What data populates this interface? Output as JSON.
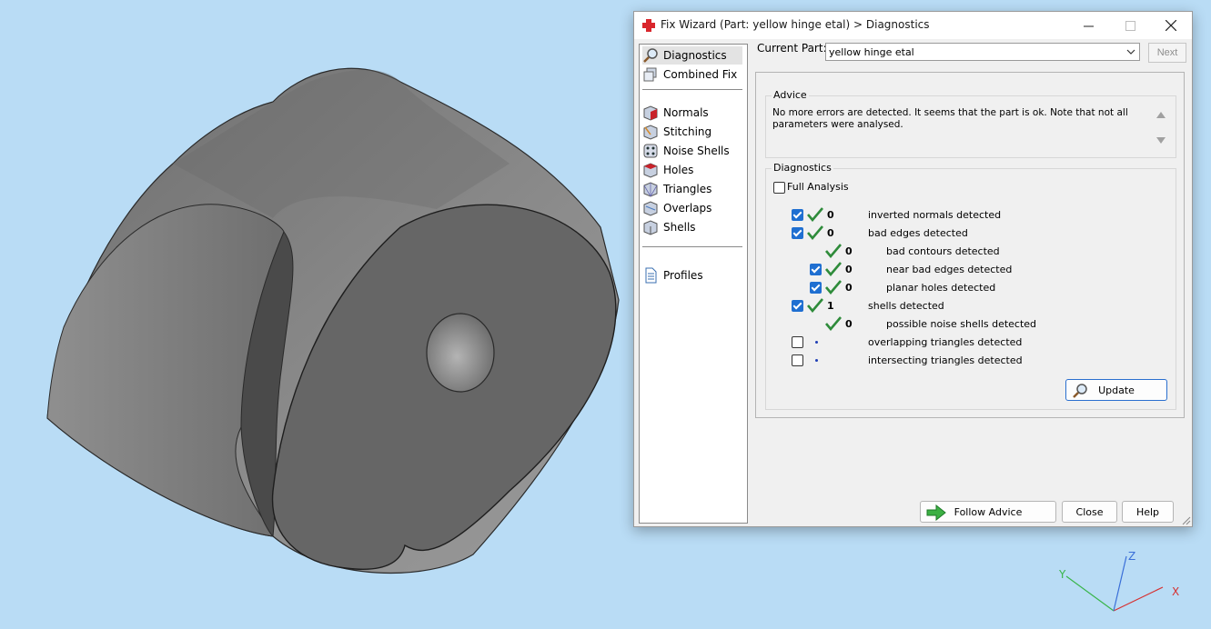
{
  "window": {
    "title": "Fix Wizard (Part: yellow hinge etal) > Diagnostics"
  },
  "nav": {
    "items": [
      {
        "label": "Diagnostics",
        "icon": "magnifier-icon"
      },
      {
        "label": "Combined Fix",
        "icon": "cubes-icon"
      },
      {
        "label": "Normals",
        "icon": "cube-red-icon"
      },
      {
        "label": "Stitching",
        "icon": "cube-stitch-icon"
      },
      {
        "label": "Noise Shells",
        "icon": "dice-icon"
      },
      {
        "label": "Holes",
        "icon": "cube-hole-icon"
      },
      {
        "label": "Triangles",
        "icon": "cube-triangles-icon"
      },
      {
        "label": "Overlaps",
        "icon": "cube-overlap-icon"
      },
      {
        "label": "Shells",
        "icon": "cube-shells-icon"
      },
      {
        "label": "Profiles",
        "icon": "document-icon"
      }
    ]
  },
  "current_part": {
    "label": "Current Part:",
    "value": "yellow hinge etal",
    "next_label": "Next"
  },
  "advice": {
    "title": "Advice",
    "text": "No more errors are detected. It seems that the part is ok. Note that not all parameters were analysed."
  },
  "diagnostics": {
    "title": "Diagnostics",
    "full_analysis_label": "Full Analysis",
    "full_analysis_checked": false,
    "rows": [
      {
        "checked": true,
        "status": "ok",
        "count": "0",
        "label": "inverted normals detected"
      },
      {
        "checked": true,
        "status": "ok",
        "count": "0",
        "label": "bad edges detected"
      },
      {
        "checked": null,
        "status": "ok",
        "count": "0",
        "label": "bad contours detected"
      },
      {
        "checked": true,
        "status": "ok",
        "count": "0",
        "label": "near bad edges detected"
      },
      {
        "checked": true,
        "status": "ok",
        "count": "0",
        "label": "planar holes detected"
      },
      {
        "checked": true,
        "status": "ok",
        "count": "1",
        "label": "shells detected"
      },
      {
        "checked": null,
        "status": "ok",
        "count": "0",
        "label": "possible noise shells detected"
      },
      {
        "checked": false,
        "status": "pending",
        "count": "",
        "label": "overlapping triangles detected"
      },
      {
        "checked": false,
        "status": "pending",
        "count": "",
        "label": "intersecting triangles detected"
      }
    ],
    "update_label": "Update"
  },
  "footer": {
    "follow_advice_label": "Follow Advice",
    "close_label": "Close",
    "help_label": "Help"
  },
  "axis": {
    "x": "X",
    "y": "Y",
    "z": "Z"
  },
  "colors": {
    "background": "#b9dcf5",
    "check_green": "#2e8b3a",
    "checkbox_blue": "#1f6fd1",
    "model_gray": "#7d7d7d"
  }
}
